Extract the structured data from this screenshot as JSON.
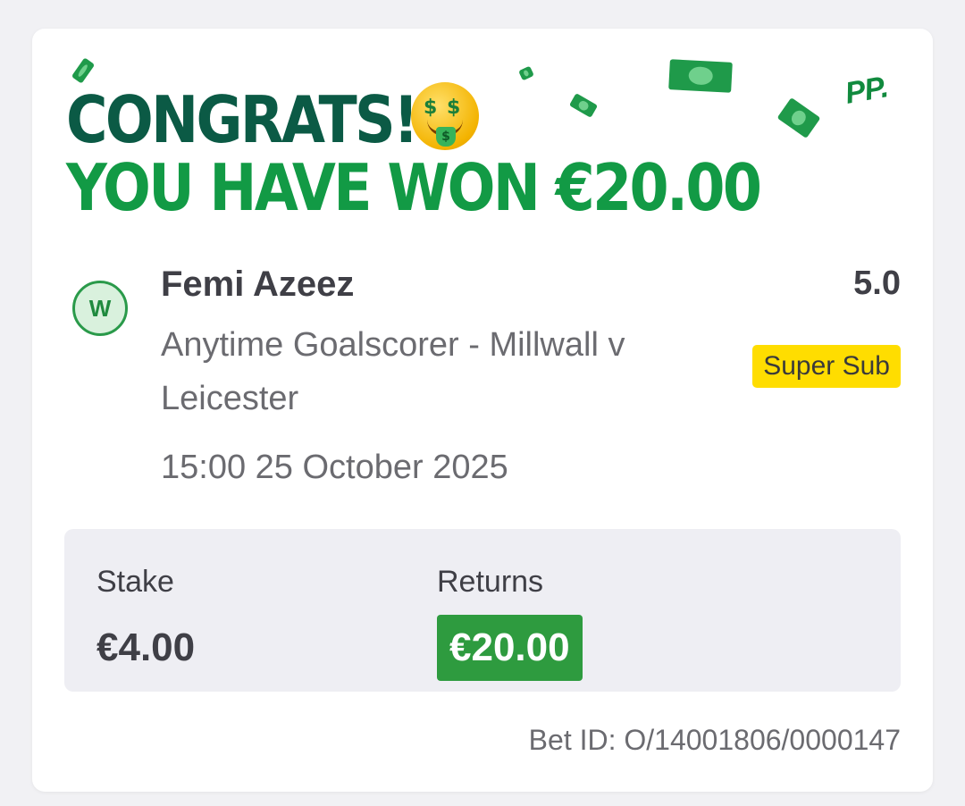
{
  "header": {
    "congrats": "CONGRATS!",
    "won_text": "YOU HAVE WON €20.00",
    "brand_logo": "PP.",
    "emoji_icon": "money-mouth-face-icon"
  },
  "bet": {
    "result_badge": "W",
    "selection": "Femi Azeez",
    "odds": "5.0",
    "market": "Anytime Goalscorer - Millwall v Leicester",
    "tag": "Super Sub",
    "event_time": "15:00 25 October 2025"
  },
  "summary": {
    "stake_label": "Stake",
    "stake_value": "€4.00",
    "returns_label": "Returns",
    "returns_value": "€20.00"
  },
  "footer": {
    "bet_id": "Bet ID: O/14001806/0000147"
  },
  "colors": {
    "headline_dark": "#0b5a45",
    "headline_green": "#129a45",
    "returns_bg": "#2e9b3f",
    "super_sub_bg": "#ffdd00",
    "win_badge_bg": "#d9f1dd"
  }
}
